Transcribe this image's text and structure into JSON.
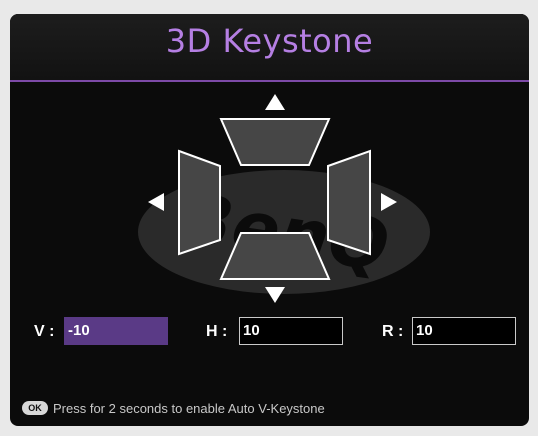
{
  "title": "3D Keystone",
  "watermark_text": "BenQ",
  "diagram": {
    "up_arrow_icon": "triangle-up",
    "down_arrow_icon": "triangle-down",
    "left_arrow_icon": "triangle-left",
    "right_arrow_icon": "triangle-right"
  },
  "fields": [
    {
      "label": "V",
      "value": "-10",
      "active": true
    },
    {
      "label": "H",
      "value": "10",
      "active": false
    },
    {
      "label": "R",
      "value": "10",
      "active": false
    }
  ],
  "hint": {
    "button": "OK",
    "text": "Press for 2 seconds to enable Auto V-Keystone"
  },
  "colors": {
    "title": "#b57fe3",
    "accent_rule": "#7d4aa7",
    "active_field": "#5a3a86",
    "background": "#0b0b0b"
  }
}
